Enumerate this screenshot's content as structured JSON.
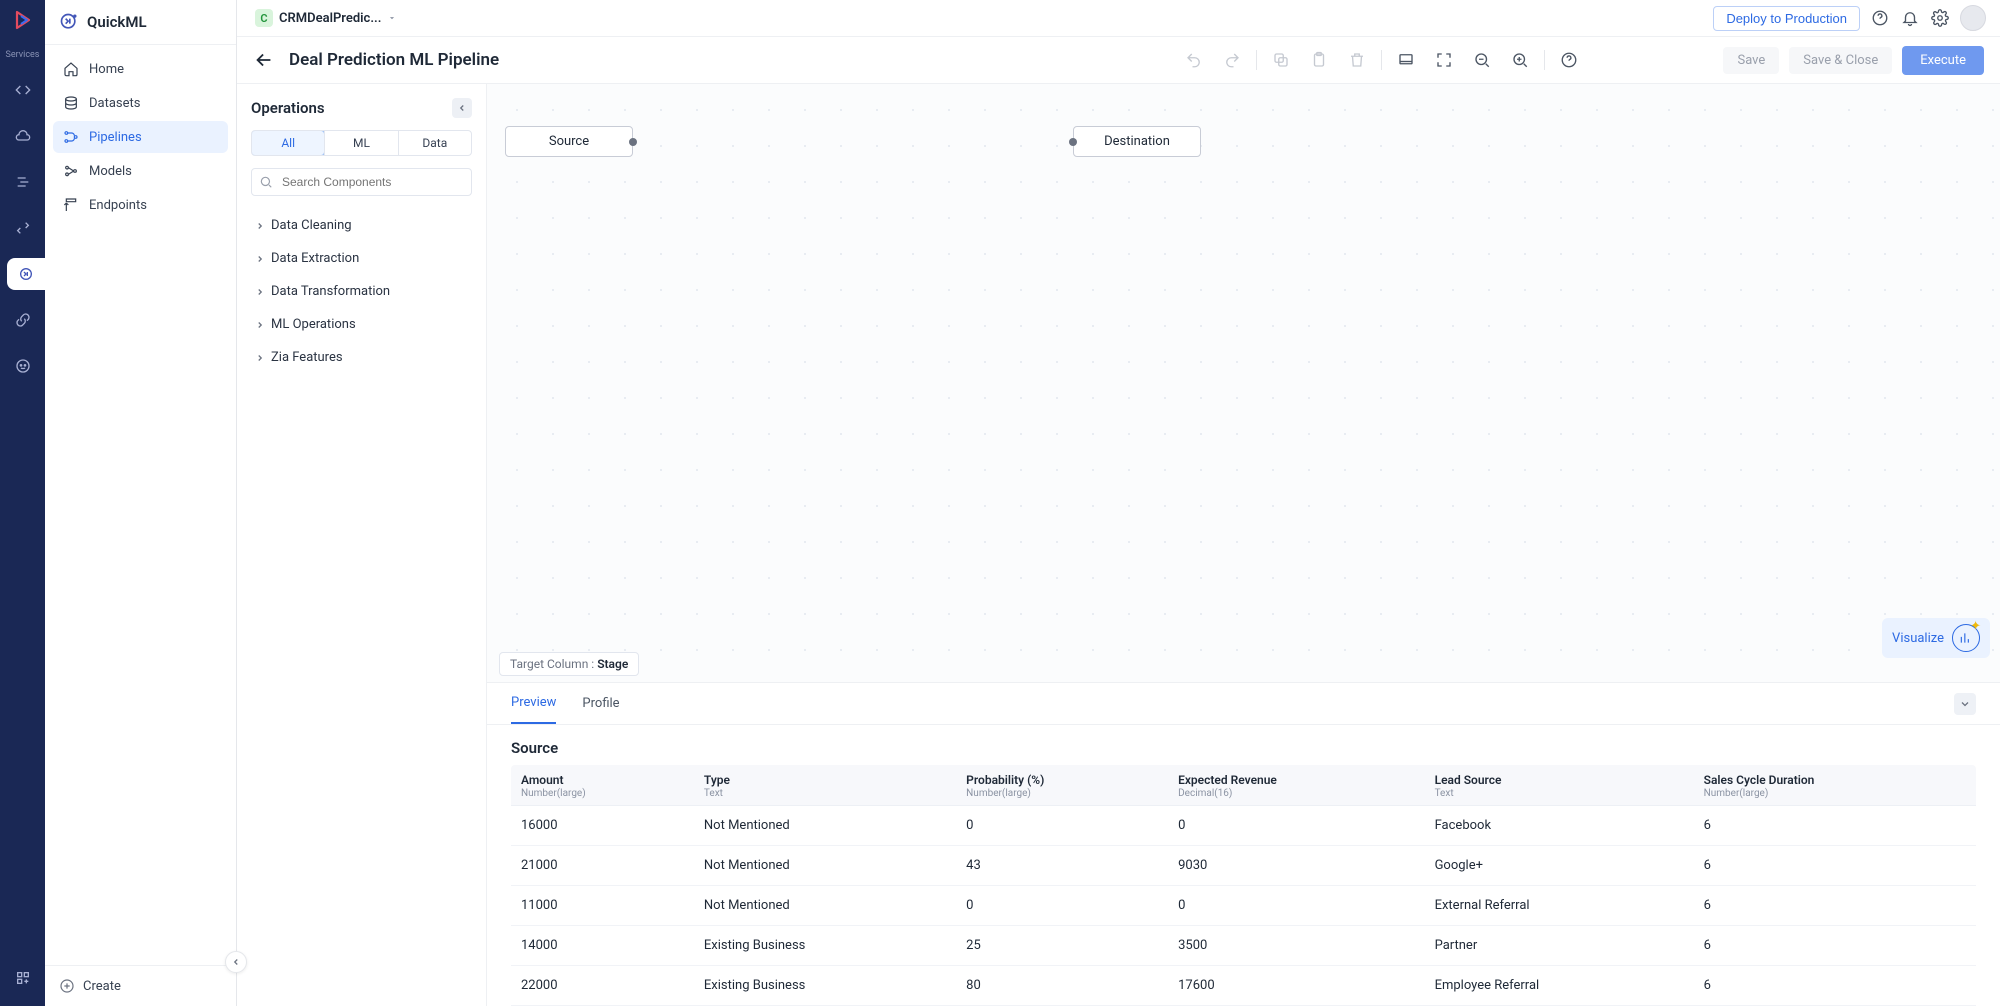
{
  "rail": {
    "services_label": "Services"
  },
  "topbar": {
    "project_letter": "C",
    "project_name": "CRMDealPredic...",
    "deploy_label": "Deploy to Production"
  },
  "brand": "QuickML",
  "nav": {
    "home": "Home",
    "datasets": "Datasets",
    "pipelines": "Pipelines",
    "models": "Models",
    "endpoints": "Endpoints",
    "create": "Create"
  },
  "titlebar": {
    "page_title": "Deal Prediction ML Pipeline",
    "save": "Save",
    "save_close": "Save & Close",
    "execute": "Execute"
  },
  "ops": {
    "title": "Operations",
    "filter_all": "All",
    "filter_ml": "ML",
    "filter_data": "Data",
    "search_placeholder": "Search Components",
    "cats": [
      "Data Cleaning",
      "Data Extraction",
      "Data Transformation",
      "ML Operations",
      "Zia Features"
    ]
  },
  "canvas": {
    "source_label": "Source",
    "dest_label": "Destination",
    "target_prefix": "Target Column : ",
    "target_value": "Stage",
    "visualize": "Visualize"
  },
  "results": {
    "tab_preview": "Preview",
    "tab_profile": "Profile",
    "table_title": "Source",
    "columns": [
      {
        "name": "Amount",
        "type": "Number(large)"
      },
      {
        "name": "Type",
        "type": "Text"
      },
      {
        "name": "Probability (%)",
        "type": "Number(large)"
      },
      {
        "name": "Expected Revenue",
        "type": "Decimal(16)"
      },
      {
        "name": "Lead Source",
        "type": "Text"
      },
      {
        "name": "Sales Cycle Duration",
        "type": "Number(large)"
      }
    ],
    "rows": [
      [
        "16000",
        "Not Mentioned",
        "0",
        "0",
        "Facebook",
        "6"
      ],
      [
        "21000",
        "Not Mentioned",
        "43",
        "9030",
        "Google+",
        "6"
      ],
      [
        "11000",
        "Not Mentioned",
        "0",
        "0",
        "External Referral",
        "6"
      ],
      [
        "14000",
        "Existing Business",
        "25",
        "3500",
        "Partner",
        "6"
      ],
      [
        "22000",
        "Existing Business",
        "80",
        "17600",
        "Employee Referral",
        "6"
      ]
    ]
  }
}
